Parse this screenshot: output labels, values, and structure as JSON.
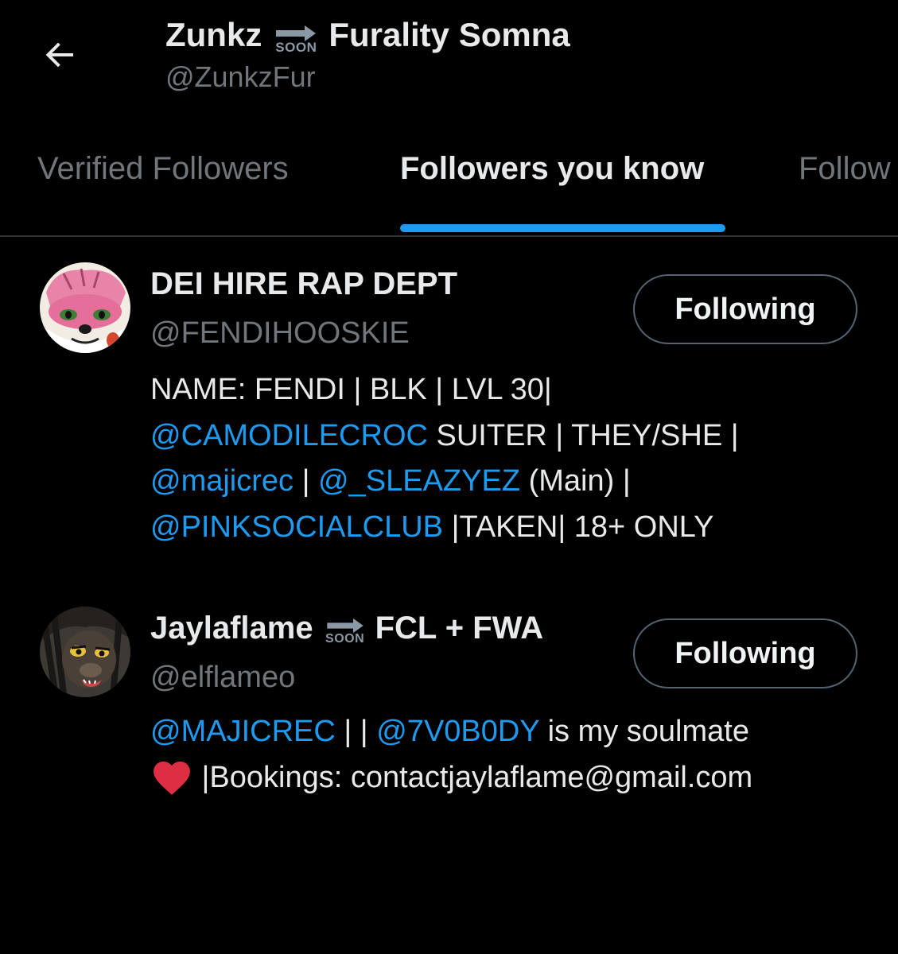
{
  "header": {
    "back_icon": "arrow-left-icon",
    "name_part1": "Zunkz",
    "soon_label": "SOON",
    "name_part2": "Furality Somna",
    "handle": "@ZunkzFur"
  },
  "tabs": [
    {
      "label": "Verified Followers",
      "active": false
    },
    {
      "label": "Followers you know",
      "active": true
    },
    {
      "label": "Follow",
      "active": false
    }
  ],
  "colors": {
    "background": "#000000",
    "accent": "#1d9bf0",
    "text_primary": "#e7e9ea",
    "text_secondary": "#71767b",
    "border": "#2f3336"
  },
  "users": [
    {
      "display_name": "DEI HIRE RAP DEPT",
      "handle": "@FENDIHOOSKIE",
      "button_label": "Following",
      "bio": {
        "l1_text1": "NAME: FENDI | BLK | LVL 30|",
        "l2_mention1": "@CAMODILECROC",
        "l2_text1": " SUITER | THEY/SHE |",
        "l3_mention1": "@majicrec",
        "l3_text1": " | ",
        "l3_mention2": "@_SLEAZYEZ",
        "l3_text2": " (Main) |",
        "l4_mention1": "@PINKSOCIALCLUB",
        "l4_text1": " |TAKEN| 18+ ONLY"
      }
    },
    {
      "display_name_part1": "Jaylaflame",
      "soon_label": "SOON",
      "display_name_part2": "FCL + FWA",
      "handle": "@elflameo",
      "button_label": "Following",
      "bio": {
        "l1_mention1": "@MAJICREC",
        "l1_text1": " | | ",
        "l1_mention2": "@7V0B0DY",
        "l1_text2": " is my soulmate",
        "l2_icon": "red-heart-icon",
        "l2_text1": " |Bookings: contactjaylaflame@gmail.com"
      }
    }
  ]
}
